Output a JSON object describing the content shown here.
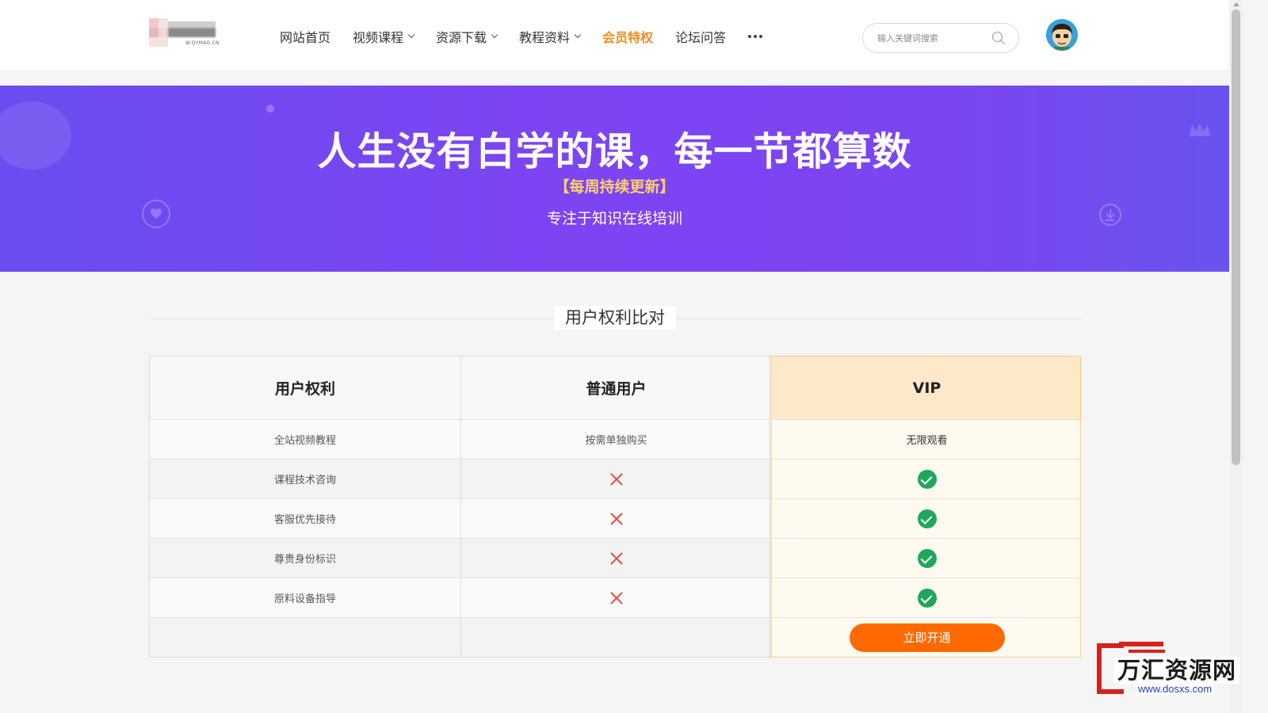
{
  "header": {
    "logo_text": "W.QYMAO.CN",
    "nav": [
      {
        "label": "网站首页",
        "dropdown": false,
        "active": false
      },
      {
        "label": "视频课程",
        "dropdown": true,
        "active": false
      },
      {
        "label": "资源下载",
        "dropdown": true,
        "active": false
      },
      {
        "label": "教程资料",
        "dropdown": true,
        "active": false
      },
      {
        "label": "会员特权",
        "dropdown": false,
        "active": true
      },
      {
        "label": "论坛问答",
        "dropdown": false,
        "active": false
      }
    ],
    "more_icon": "more-dots-icon",
    "search": {
      "placeholder": "输入关键词搜索",
      "icon": "search-icon"
    },
    "avatar_icon": "avatar-icon"
  },
  "banner": {
    "title": "人生没有白学的课，每一节都算数",
    "subtitle": "【每周持续更新】",
    "description": "专注于知识在线培训"
  },
  "section": {
    "title": "用户权利比对"
  },
  "table": {
    "headers": [
      "用户权利",
      "普通用户",
      "VIP"
    ],
    "rows": [
      {
        "feature": "全站视频教程",
        "normal": "按需单独购买",
        "vip": "无限观看"
      },
      {
        "feature": "课程技术咨询",
        "normal": "cross-icon",
        "vip": "check-icon"
      },
      {
        "feature": "客服优先接待",
        "normal": "cross-icon",
        "vip": "check-icon"
      },
      {
        "feature": "尊贵身份标识",
        "normal": "cross-icon",
        "vip": "check-icon"
      },
      {
        "feature": "原料设备指导",
        "normal": "cross-icon",
        "vip": "check-icon"
      }
    ],
    "action_label": "立即开通"
  },
  "watermark": {
    "text": "万汇资源网",
    "url": "www.dosxs.com"
  },
  "colors": {
    "accent_orange": "#ff6a00",
    "nav_active": "#f08e1e",
    "banner_purple": "#7d44f2",
    "subtitle_yellow": "#ffd166",
    "check_green": "#20a85a",
    "cross_red": "#e64a3c",
    "vip_header_bg": "#fde9c9"
  }
}
